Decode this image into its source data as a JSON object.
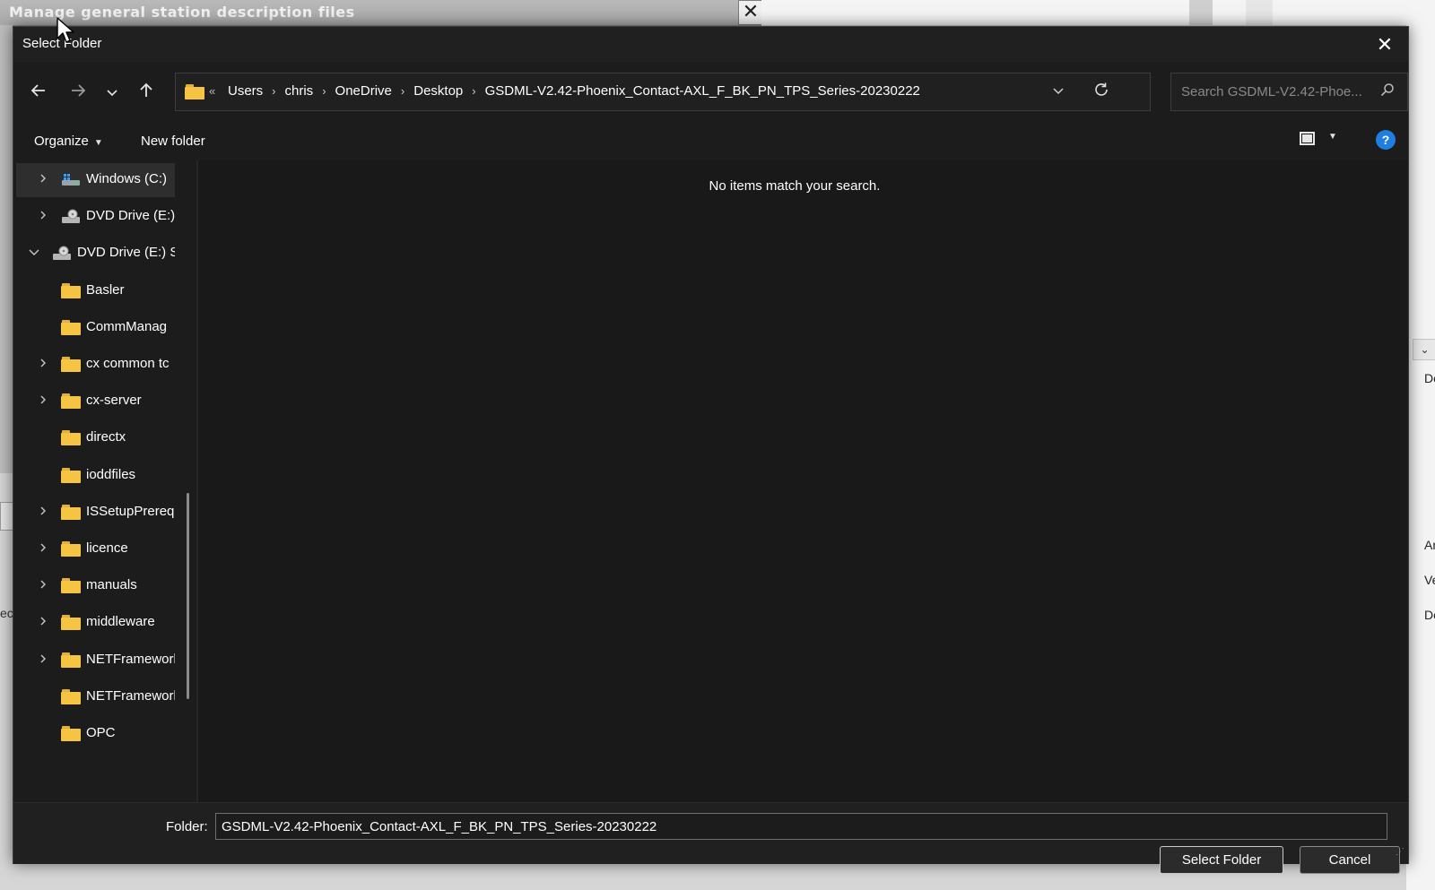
{
  "background": {
    "window_title": "Manage general station description files",
    "close_glyph": "✕",
    "left_text": "ec",
    "right_texts": [
      "De",
      "Ar",
      "Ve",
      "De"
    ]
  },
  "dialog": {
    "title": "Select Folder",
    "close_glyph": "✕",
    "nav": {
      "back_icon": "arrow-left-icon",
      "forward_icon": "arrow-right-icon",
      "recent_icon": "chevron-down-icon",
      "up_icon": "arrow-up-icon"
    },
    "address": {
      "overflow_glyph": "«",
      "crumbs": [
        "Users",
        "chris",
        "OneDrive",
        "Desktop",
        "GSDML-V2.42-Phoenix_Contact-AXL_F_BK_PN_TPS_Series-20230222"
      ],
      "separator": "›"
    },
    "search": {
      "placeholder": "Search GSDML-V2.42-Phoe..."
    },
    "toolbar": {
      "organize": "Organize",
      "new_folder": "New folder",
      "help": "?"
    },
    "tree": [
      {
        "label": "Windows (C:)",
        "expander": ">",
        "icon": "windows-drive-icon",
        "selected": true
      },
      {
        "label": "DVD Drive (E:)",
        "expander": ">",
        "icon": "dvd-drive-icon"
      },
      {
        "label": "DVD Drive (E:) Sy",
        "expander": "v",
        "icon": "dvd-drive-icon"
      },
      {
        "label": "Basler",
        "expander": "",
        "icon": "folder-icon"
      },
      {
        "label": "CommManag",
        "expander": "",
        "icon": "folder-icon"
      },
      {
        "label": "cx common tc",
        "expander": ">",
        "icon": "folder-icon"
      },
      {
        "label": "cx-server",
        "expander": ">",
        "icon": "folder-icon"
      },
      {
        "label": "directx",
        "expander": "",
        "icon": "folder-icon"
      },
      {
        "label": "ioddfiles",
        "expander": "",
        "icon": "folder-icon"
      },
      {
        "label": "ISSetupPrereq",
        "expander": ">",
        "icon": "folder-icon"
      },
      {
        "label": "licence",
        "expander": ">",
        "icon": "folder-icon"
      },
      {
        "label": "manuals",
        "expander": ">",
        "icon": "folder-icon"
      },
      {
        "label": "middleware",
        "expander": ">",
        "icon": "folder-icon"
      },
      {
        "label": "NETFramework",
        "expander": ">",
        "icon": "folder-icon"
      },
      {
        "label": "NETFramework",
        "expander": "",
        "icon": "folder-icon"
      },
      {
        "label": "OPC",
        "expander": "",
        "icon": "folder-icon"
      }
    ],
    "content": {
      "empty_message": "No items match your search."
    },
    "bottom": {
      "folder_label": "Folder:",
      "folder_value": "GSDML-V2.42-Phoenix_Contact-AXL_F_BK_PN_TPS_Series-20230222",
      "select_button": "Select Folder",
      "cancel_button": "Cancel"
    }
  },
  "colors": {
    "dialog_bg": "#1c1c1c",
    "folder_yellow": "#f6c443",
    "help_blue": "#1f7fe0"
  }
}
